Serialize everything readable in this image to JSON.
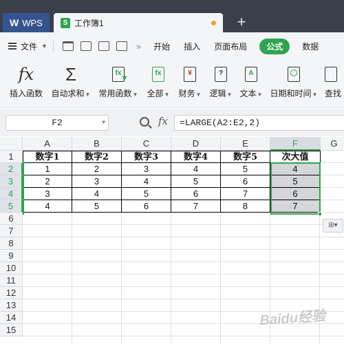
{
  "app": {
    "logo_text": "WPS",
    "tab_title": "工作簿1",
    "doc_icon": "S"
  },
  "menu": {
    "file_label": "文件",
    "items": [
      "开始",
      "插入",
      "页面布局",
      "公式",
      "数据"
    ],
    "active": "公式"
  },
  "ribbon": {
    "insert_function": "插入函数",
    "autosum": "自动求和",
    "common_functions": "常用函数",
    "all": "全部",
    "finance": "财务",
    "logic": "逻辑",
    "text": "文本",
    "datetime": "日期和时间",
    "lookup": "查找"
  },
  "formula_bar": {
    "cell_ref": "F2",
    "fx_label": "fx",
    "formula": "=LARGE(A2:E2,2)"
  },
  "sheet": {
    "columns": [
      "A",
      "B",
      "C",
      "D",
      "E",
      "F",
      "G"
    ],
    "rows": [
      "1",
      "2",
      "3",
      "4",
      "5",
      "6",
      "7",
      "8",
      "9",
      "10",
      "11",
      "12",
      "13",
      "14",
      "15"
    ],
    "headers": [
      "数字1",
      "数字2",
      "数字3",
      "数字4",
      "数字5",
      "次大值"
    ],
    "data": [
      [
        "1",
        "2",
        "3",
        "4",
        "5",
        "4"
      ],
      [
        "2",
        "3",
        "4",
        "5",
        "6",
        "5"
      ],
      [
        "3",
        "4",
        "5",
        "6",
        "7",
        "6"
      ],
      [
        "4",
        "5",
        "6",
        "7",
        "8",
        "7"
      ]
    ]
  },
  "colors": {
    "accent": "#2ea44f",
    "titlebar": "#3a3f4a",
    "wps_tab": "#35548f"
  },
  "watermark": "Baidu经验"
}
